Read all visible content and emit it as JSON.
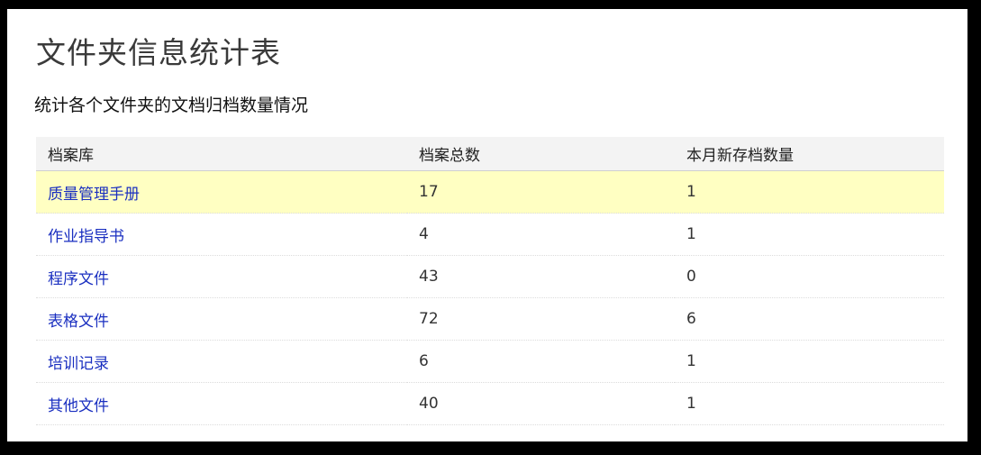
{
  "page": {
    "title": "文件夹信息统计表",
    "subtitle": "统计各个文件夹的文档归档数量情况"
  },
  "table": {
    "headers": [
      "档案库",
      "档案总数",
      "本月新存档数量"
    ],
    "rows": [
      {
        "name": "质量管理手册",
        "total": "17",
        "new_this_month": "1",
        "highlighted": true
      },
      {
        "name": "作业指导书",
        "total": "4",
        "new_this_month": "1",
        "highlighted": false
      },
      {
        "name": "程序文件",
        "total": "43",
        "new_this_month": "0",
        "highlighted": false
      },
      {
        "name": "表格文件",
        "total": "72",
        "new_this_month": "6",
        "highlighted": false
      },
      {
        "name": "培训记录",
        "total": "6",
        "new_this_month": "1",
        "highlighted": false
      },
      {
        "name": "其他文件",
        "total": "40",
        "new_this_month": "1",
        "highlighted": false
      }
    ]
  },
  "colors": {
    "highlight_row": "#ffffc2",
    "link": "#1a2fc0",
    "header_bg": "#f3f3f3"
  }
}
